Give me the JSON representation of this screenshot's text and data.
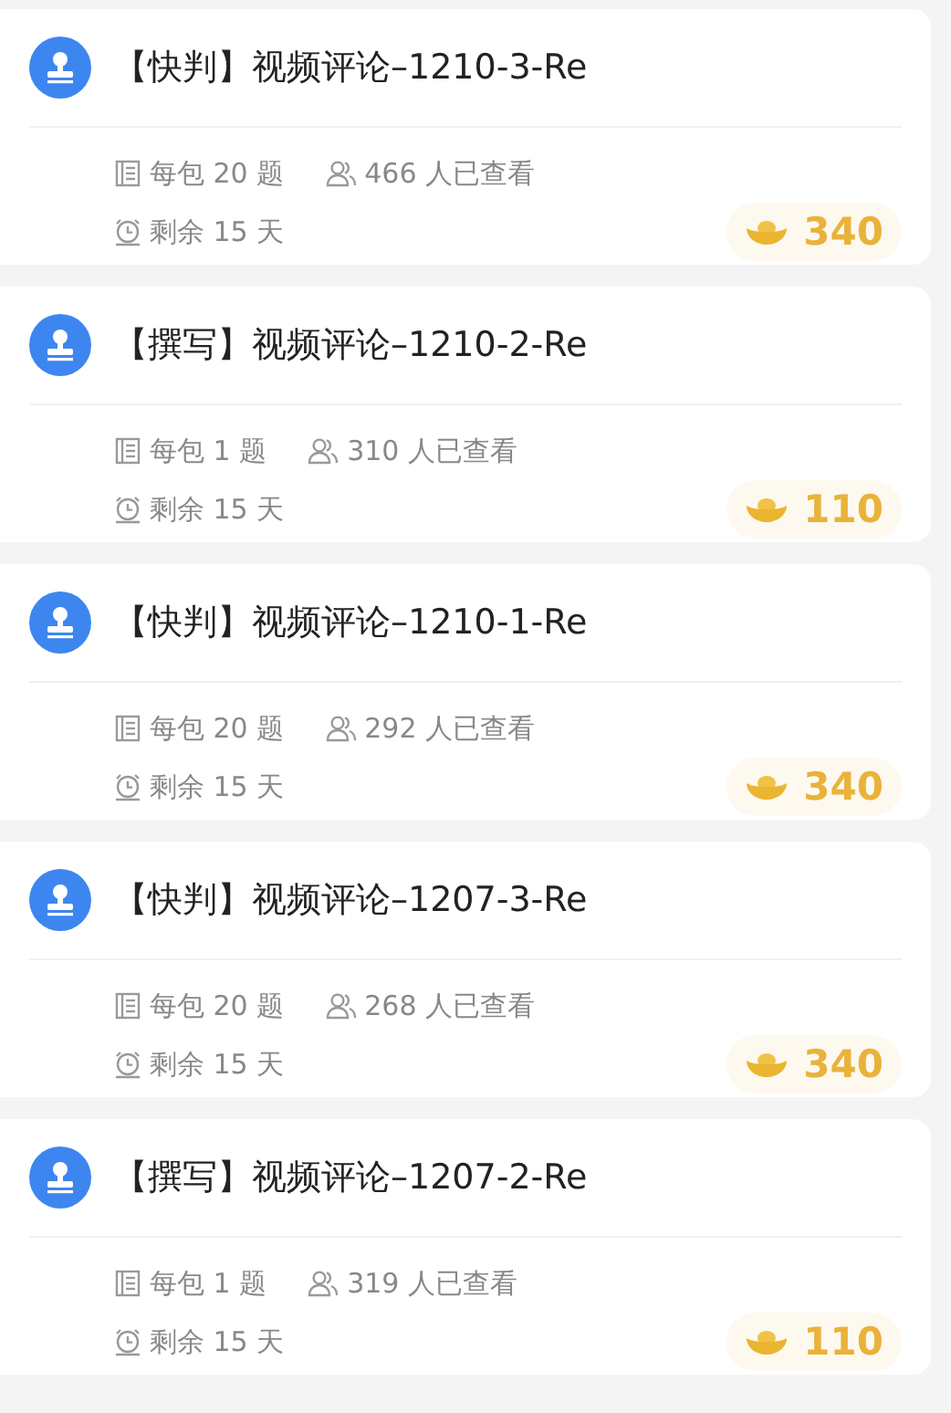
{
  "tasks": [
    {
      "title": "【快判】视频评论–1210-3-Re",
      "per_pack": "每包 20 题",
      "viewers": "466 人已查看",
      "remaining": "剩余 15 天",
      "reward": "340"
    },
    {
      "title": "【撰写】视频评论–1210-2-Re",
      "per_pack": "每包 1 题",
      "viewers": "310 人已查看",
      "remaining": "剩余 15 天",
      "reward": "110"
    },
    {
      "title": "【快判】视频评论–1210-1-Re",
      "per_pack": "每包 20 题",
      "viewers": "292 人已查看",
      "remaining": "剩余 15 天",
      "reward": "340"
    },
    {
      "title": "【快判】视频评论–1207-3-Re",
      "per_pack": "每包 20 题",
      "viewers": "268 人已查看",
      "remaining": "剩余 15 天",
      "reward": "340"
    },
    {
      "title": "【撰写】视频评论–1207-2-Re",
      "per_pack": "每包 1 题",
      "viewers": "319 人已查看",
      "remaining": "剩余 15 天",
      "reward": "110"
    }
  ]
}
